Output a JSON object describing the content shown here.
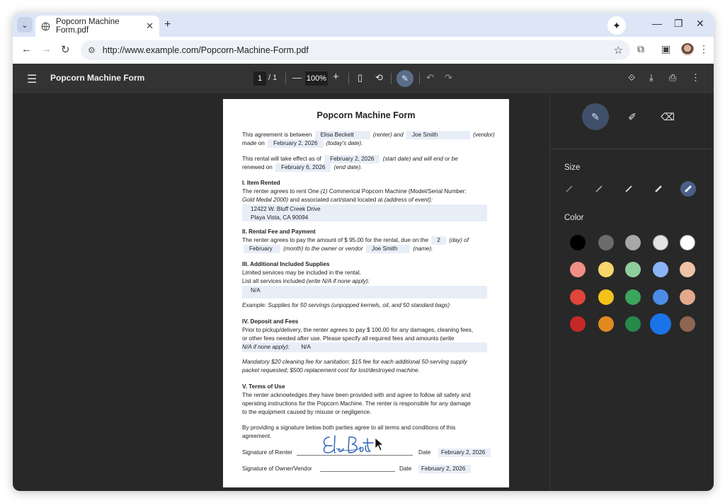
{
  "browser": {
    "tab_title": "Popcorn Machine Form.pdf",
    "url": "http://www.example.com/Popcorn-Machine-Form.pdf"
  },
  "pdf_toolbar": {
    "doc_title": "Popcorn Machine Form",
    "current_page": "1",
    "total_pages": "/ 1",
    "zoom": "100%"
  },
  "form": {
    "title": "Popcorn Machine Form",
    "agreement": {
      "t1": "This agreement is between",
      "renter": "Elisa Beckett",
      "t2": "(renter) and",
      "vendor": "Joe Smith",
      "t3": "(vendor)",
      "t4": "made on",
      "date": "February 2, 2026",
      "t5": "(today's date)."
    },
    "rental": {
      "t1": "This rental will take effect as of",
      "start": "February 2, 2026",
      "t2": "(start date) and will end or be",
      "t3": "renewed on",
      "end": "February 6, 2026",
      "t4": "(end date)."
    },
    "item": {
      "heading": "I. Item Rented",
      "l1a": "The renter agrees to rent One",
      "l1b": "(1)",
      "l1c": "Commerical Popcorn Machine (Model/Serial Number:",
      "l2a": "Gold Medal 2000)",
      "l2b": "and associated cart/stand located at",
      "l2c": "(address of event):",
      "addr1": "12422 W. Bluff Creek Drive",
      "addr2": "Playa Vista, CA 90094"
    },
    "fee": {
      "heading": "II. Rental Fee and Payment",
      "l1a": "The renter agrees to pay the amount of $ 95.00 for the rental, due on the",
      "day": "2",
      "l1b": "(day) of",
      "month": "February",
      "l2a": "(month) to the owner or vendor",
      "owner": "Joe Smith",
      "l2b": "(name)."
    },
    "supplies": {
      "heading": "III. Additional Included Supplies",
      "l1": "Limited services may be included in the rental.",
      "l2a": "List all services included",
      "l2b": "(write N/A if none apply):",
      "value": "N/A",
      "example": "Example: Supplies for 50 servings (unpopped kernels, oil, and 50 standard bags)"
    },
    "deposit": {
      "heading": "IV. Deposit and Fees",
      "l1": "Prior to pickup/delivery, the renter agrees to pay $ 100.00 for any damages, cleaning fees,",
      "l2": "or other fees needed after use. Please specify all required fees and amounts (write",
      "l3": "N/A if none apply):",
      "value": "N/A",
      "n1": "Mandatory $20 cleaning fee for sanitation; $15 fee for each additional 50-serving supply",
      "n2": "packet requested; $500 replacement cost for lost/destroyed machine."
    },
    "terms": {
      "heading": "V. Terms of Use",
      "l1": "The renter acknowledges they have been provided with and agree to follow all safety and",
      "l2": "operating instructions for the Popcorn Machine. The renter is responsible for any damage",
      "l3": "to the equipment caused by misuse or negligence."
    },
    "signing": {
      "l1": "By providing a signature below both parties agree to all terms and conditions of this",
      "l2": "agreement.",
      "renter_label": "Signature of Renter",
      "date_label": "Date",
      "renter_date": "February 2, 2026",
      "owner_label": "Signature of Owner/Vendor",
      "owner_date": "February 2, 2026"
    }
  },
  "annotation_panel": {
    "size_label": "Size",
    "color_label": "Color",
    "colors": [
      "#000000",
      "#6b6b6b",
      "#a7a7a7",
      "#e3e3e3",
      "#ffffff",
      "#ef8f86",
      "#f6d56c",
      "#8fcf9c",
      "#8ab4f8",
      "#efc3a8",
      "#e0453a",
      "#f2c21b",
      "#3da55b",
      "#4b8ce6",
      "#e2a98c",
      "#c62828",
      "#e08a1e",
      "#25894a",
      "#1a73e8",
      "#8d6651"
    ],
    "selected_color": "#1a73e8"
  }
}
